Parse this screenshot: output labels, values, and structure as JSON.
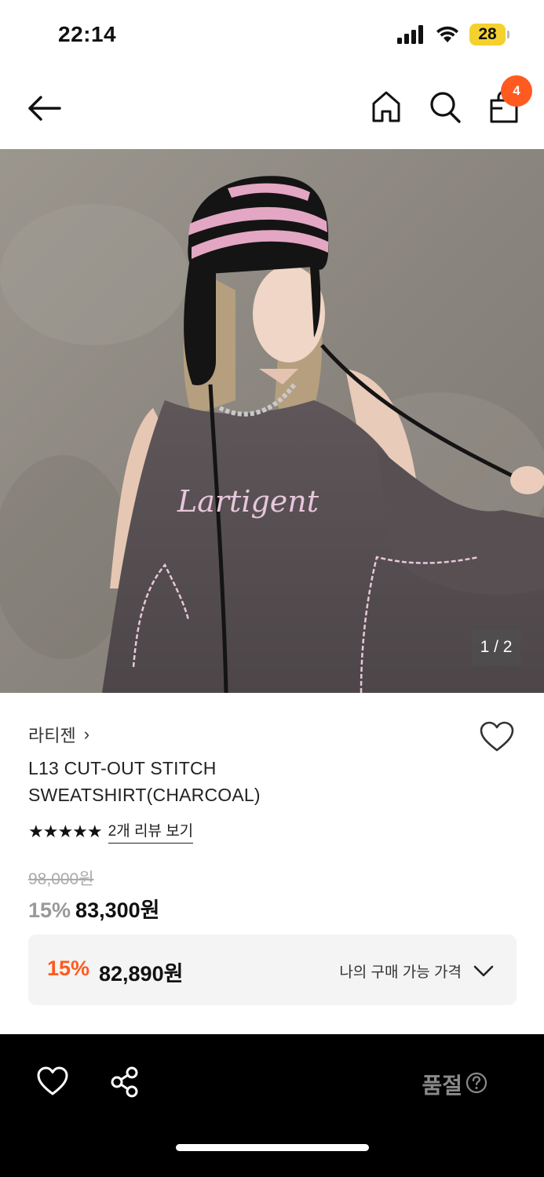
{
  "status_bar": {
    "time": "22:14",
    "battery_level": "28"
  },
  "nav": {
    "cart_count": "4",
    "icons": [
      "back-arrow-icon",
      "home-icon",
      "search-icon",
      "cart-icon"
    ]
  },
  "gallery": {
    "counter": "1 / 2",
    "image_description_icon": "product-photo",
    "print_text": "Lartigent"
  },
  "product": {
    "brand": "라티젠",
    "brand_chevron": "›",
    "name_line1": "L13 CUT-OUT STITCH",
    "name_line2": "SWEATSHIRT(CHARCOAL)",
    "rating_stars": "★★★★★",
    "rating_value": 5,
    "review_link": "2개 리뷰 보기",
    "original_price": "98,000원",
    "discount_rate": "15%",
    "sale_price": "83,300원"
  },
  "member_price": {
    "discount_rate": "15%",
    "price": "82,890원",
    "label": "나의 구매 가능 가격"
  },
  "bottom_bar": {
    "status": "품절",
    "icons": [
      "heart-icon",
      "share-icon",
      "help-icon"
    ]
  },
  "colors": {
    "accent": "#ff5a1f",
    "battery": "#f5d130",
    "bottom_bar": "#000000",
    "soldout_text": "#8a8a8a"
  }
}
